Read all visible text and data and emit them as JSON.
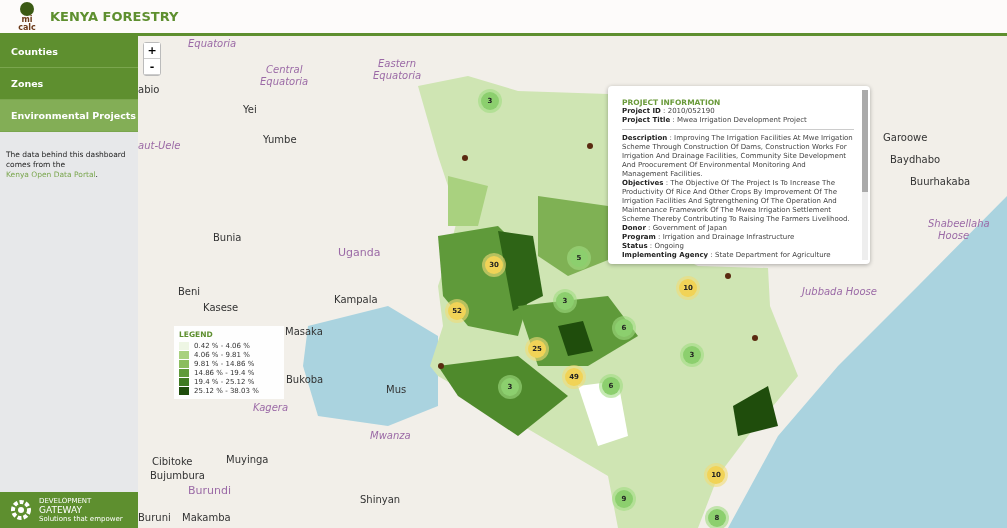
{
  "header": {
    "logo_lines": [
      "mi",
      "calc"
    ],
    "title": "KENYA FORESTRY"
  },
  "sidebar": {
    "items": [
      {
        "label": "Counties",
        "selected": false
      },
      {
        "label": "Zones",
        "selected": false
      },
      {
        "label": "Environmental Projects",
        "selected": true
      }
    ],
    "note_before": "The data behind this dashboard comes from the ",
    "note_link": "Kenya Open Data Portal",
    "note_after": ".",
    "footer": {
      "line1": "DEVELOPMENT",
      "line2": "GATEWAY",
      "line3": "Solutions that empower"
    }
  },
  "zoom": {
    "plus": "+",
    "minus": "-"
  },
  "map_labels": [
    {
      "text": "Equatoria",
      "kind": "region"
    },
    {
      "text": "Central",
      "kind": "region"
    },
    {
      "text": "Equatoria",
      "kind": "region"
    },
    {
      "text": "Eastern",
      "kind": "region"
    },
    {
      "text": "Equatoria",
      "kind": "region"
    },
    {
      "text": "abio",
      "kind": "city"
    },
    {
      "text": "Yei",
      "kind": "city"
    },
    {
      "text": "Yumbe",
      "kind": "city"
    },
    {
      "text": "aut-Uele",
      "kind": "region"
    },
    {
      "text": "Bunia",
      "kind": "city"
    },
    {
      "text": "Uganda",
      "kind": "country"
    },
    {
      "text": "Beni",
      "kind": "city"
    },
    {
      "text": "Kasese",
      "kind": "city"
    },
    {
      "text": "Kampala",
      "kind": "city"
    },
    {
      "text": "Masaka",
      "kind": "city"
    },
    {
      "text": "Bukoba",
      "kind": "city"
    },
    {
      "text": "Mus",
      "kind": "city"
    },
    {
      "text": "Kagera",
      "kind": "region"
    },
    {
      "text": "Mwanza",
      "kind": "region"
    },
    {
      "text": "Cibitoke",
      "kind": "city"
    },
    {
      "text": "Bujumbura",
      "kind": "city"
    },
    {
      "text": "Muyinga",
      "kind": "city"
    },
    {
      "text": "Burundi",
      "kind": "country"
    },
    {
      "text": "Shinyan",
      "kind": "city"
    },
    {
      "text": "Buruni",
      "kind": "city"
    },
    {
      "text": "Makamba",
      "kind": "city"
    },
    {
      "text": "Baydhabo",
      "kind": "city"
    },
    {
      "text": "Buurhakaba",
      "kind": "city"
    },
    {
      "text": "Garoowe",
      "kind": "city"
    },
    {
      "text": "Jubbada Hoose",
      "kind": "region"
    },
    {
      "text": "Shabeellaha",
      "kind": "region"
    },
    {
      "text": "Hoose",
      "kind": "region"
    }
  ],
  "clusters": [
    {
      "count": "3",
      "kind": "small"
    },
    {
      "count": "30",
      "kind": "medium"
    },
    {
      "count": "52",
      "kind": "medium"
    },
    {
      "count": "5",
      "kind": "small"
    },
    {
      "count": "3",
      "kind": "small"
    },
    {
      "count": "6",
      "kind": "small"
    },
    {
      "count": "25",
      "kind": "medium"
    },
    {
      "count": "49",
      "kind": "medium"
    },
    {
      "count": "6",
      "kind": "small"
    },
    {
      "count": "3",
      "kind": "small"
    },
    {
      "count": "3",
      "kind": "small"
    },
    {
      "count": "10",
      "kind": "medium"
    },
    {
      "count": "10",
      "kind": "medium"
    },
    {
      "count": "9",
      "kind": "small"
    },
    {
      "count": "8",
      "kind": "small"
    }
  ],
  "popup": {
    "title": "PROJECT INFORMATION",
    "fields": [
      {
        "key": "Project ID",
        "value": ": 2010/052190",
        "divider": false
      },
      {
        "key": "Project Title",
        "value": ": Mwea Irrigation Development Project",
        "divider": true
      },
      {
        "key": "Description",
        "value": ": Improving The Irrigation Facilities At Mwe Irrigation Scheme Through Construction Of Dams, Construction Works For Irrigation And Drainage Facilities, Community Site Development And Proocurement Of Environmental Monitoring And Management Facilities.",
        "divider": false
      },
      {
        "key": "Objectives",
        "value": ": The Objective Of The Project Is To Increase The Productivity Of Rice And Other Crops By Improvement Of The Irrigation Facilities And Sgtrengthening Of The Operation And Maintenance Framework Of The Mwea Irrigation Settlement Scheme Thereby Contributing To Raising The Farmers Livelihood.",
        "divider": false
      },
      {
        "key": "Donor",
        "value": ": Government of Japan",
        "divider": false
      },
      {
        "key": "Program",
        "value": ": Irrigation and Drainage Infrastructure",
        "divider": false
      },
      {
        "key": "Status",
        "value": ": Ongoing",
        "divider": false
      },
      {
        "key": "Implementing Agency",
        "value": ": State Department for Agriculture",
        "divider": false
      }
    ]
  },
  "legend": {
    "title": "LEGEND",
    "items": [
      {
        "label": "0.42 % - 4.06 %",
        "color": "#eef6e4"
      },
      {
        "label": "4.06 % - 9.81 %",
        "color": "#a9d17f"
      },
      {
        "label": "9.81 % - 14.86 %",
        "color": "#8bbd5e"
      },
      {
        "label": "14.86 % - 19.4 %",
        "color": "#5f9a3a"
      },
      {
        "label": "19.4 % - 25.12 %",
        "color": "#3f7a22"
      },
      {
        "label": "25.12 % - 38.03 %",
        "color": "#1f4d0c"
      }
    ]
  }
}
